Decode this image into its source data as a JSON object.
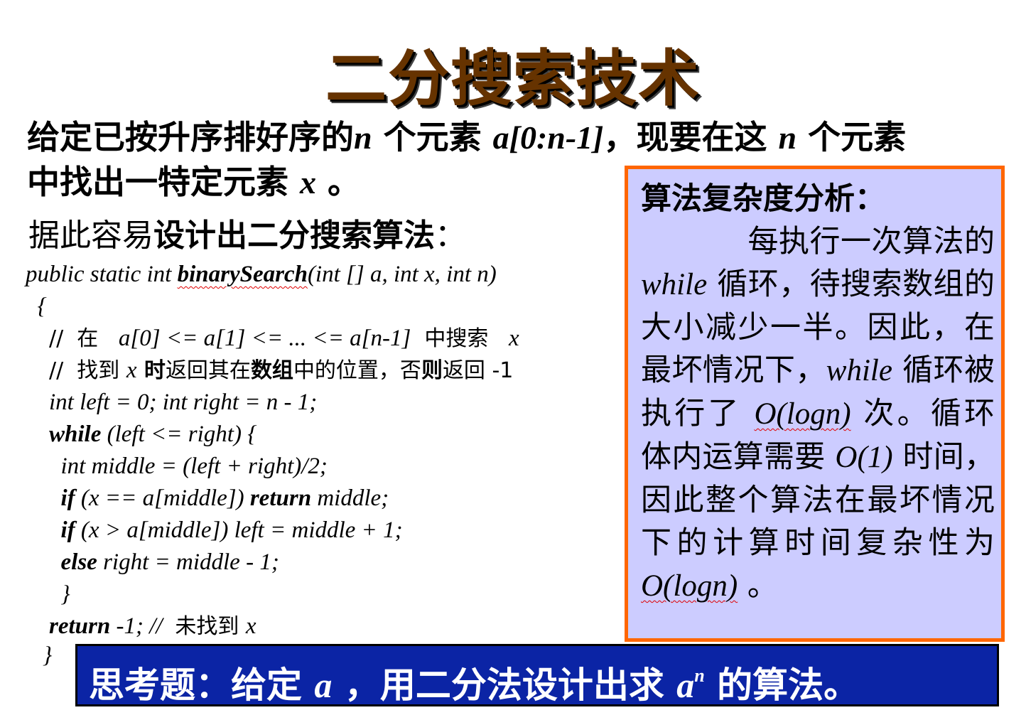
{
  "title": "二分搜索技术",
  "intro": {
    "p1": "给定已按升序排好序的",
    "n1": "n",
    "p2": " 个元素 ",
    "arr": "a[0:n-1]",
    "p3": "，现要在这 ",
    "n2": "n",
    "p4": " 个元素",
    "p5": "中找出一特定元素 ",
    "x": "x",
    "p6": " 。"
  },
  "lead": {
    "plain1": "据此容易",
    "bold": "设计出二分搜索算法",
    "plain2": "："
  },
  "code": {
    "sig_prefix": "public static int ",
    "sig_name": "binarySearch",
    "sig_suffix": "(int [] a, int x, int n)",
    "open_brace": "{",
    "c1_a": "//  在   ",
    "c1_b": "a[0] <= a[1] <= ... <= a[n-1]",
    "c1_c": "  中搜索   ",
    "c1_d": "x",
    "c2_a": "//  找到 ",
    "c2_x": "x",
    "c2_b": " 时",
    "c2_c": "返回其在",
    "c2_d": "数组",
    "c2_e": "中的位置，否",
    "c2_f": "则",
    "c2_g": "返回 -1",
    "l3": "int left = 0; int right = n - 1;",
    "l4_kw": "while",
    "l4_rest": " (left <= right) {",
    "l5": "int middle = (left + right)/2;",
    "l6_kw": "if",
    "l6_a": " (x == a[middle]) ",
    "l6_kw2": "return",
    "l6_b": " middle;",
    "l7_kw": "if",
    "l7_rest": " (x > a[middle]) left = middle + 1;",
    "l8_kw": "else",
    "l8_rest": " right = middle - 1;",
    "l9": "}",
    "l10_kw": "return",
    "l10_a": " -1; // ",
    "l10_b": " 未找到 ",
    "l10_x": "x",
    "close_brace": "}"
  },
  "panel": {
    "heading": "算法复杂度分析：",
    "t1": "每执行一次算法的 ",
    "w1": "while",
    "t2": " 循环，待搜索数组的大小减少一半。因此，在最坏情况下，",
    "w2": "while",
    "t3": " 循环被执行了 ",
    "o1": "O(logn)",
    "t4": " 次。循环体内运算需要 ",
    "o2": "O(1)",
    "t5": " 时间，因此整个算法在最坏情况下的计算时间复杂性为 ",
    "o3": "O(logn)",
    "t6": " 。"
  },
  "think": {
    "a": "思考题：给定 ",
    "var": "a",
    "b": " ，用二分法设计出求 ",
    "pow_base": "a",
    "pow_exp": "n",
    "c": " 的算法。"
  },
  "colors": {
    "title": "#663300",
    "panel_bg": "#ccccff",
    "panel_border": "#ff6600",
    "think_bg": "#0b24a5"
  }
}
